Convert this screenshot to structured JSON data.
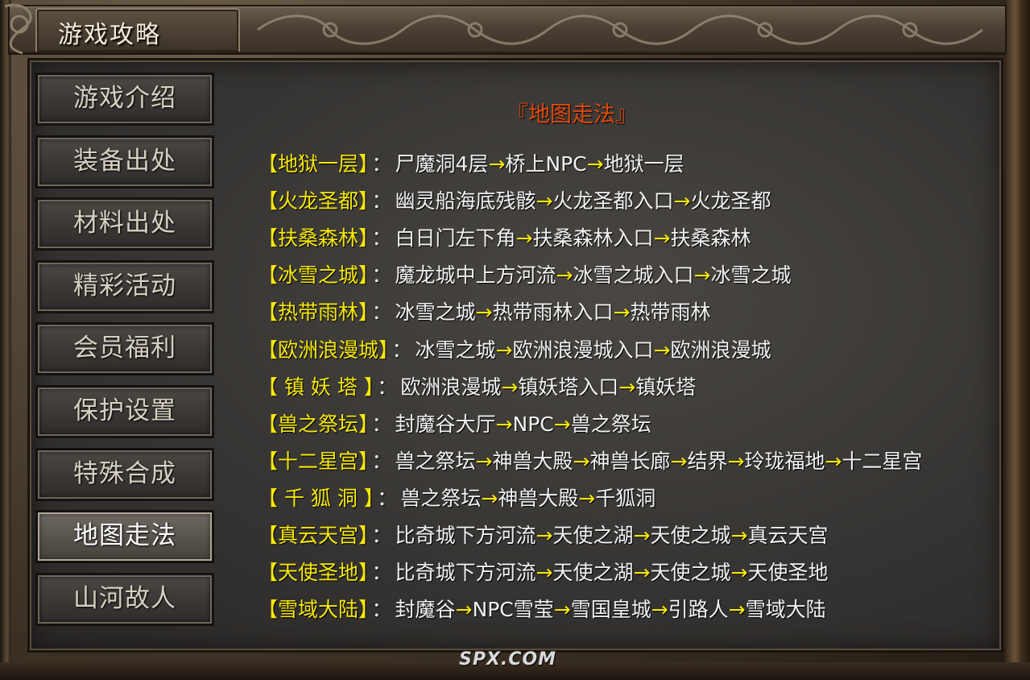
{
  "window": {
    "title": "游戏攻略"
  },
  "sidebar": {
    "items": [
      {
        "label": "游戏介绍",
        "active": false
      },
      {
        "label": "装备出处",
        "active": false
      },
      {
        "label": "材料出处",
        "active": false
      },
      {
        "label": "精彩活动",
        "active": false
      },
      {
        "label": "会员福利",
        "active": false
      },
      {
        "label": "保护设置",
        "active": false
      },
      {
        "label": "特殊合成",
        "active": false
      },
      {
        "label": "地图走法",
        "active": true
      },
      {
        "label": "山河故人",
        "active": false
      }
    ]
  },
  "content": {
    "title": "『地图走法』",
    "separator": "：",
    "arrow": "→",
    "routes": [
      {
        "name": "【地狱一层】",
        "steps": [
          "尸魔洞4层",
          "桥上NPC",
          "地狱一层"
        ]
      },
      {
        "name": "【火龙圣都】",
        "steps": [
          "幽灵船海底残骸",
          "火龙圣都入口",
          "火龙圣都"
        ]
      },
      {
        "name": "【扶桑森林】",
        "steps": [
          "白日门左下角",
          "扶桑森林入口",
          "扶桑森林"
        ]
      },
      {
        "name": "【冰雪之城】",
        "steps": [
          "魔龙城中上方河流",
          "冰雪之城入口",
          "冰雪之城"
        ]
      },
      {
        "name": "【热带雨林】",
        "steps": [
          "冰雪之城",
          "热带雨林入口",
          "热带雨林"
        ]
      },
      {
        "name": "【欧洲浪漫城】",
        "steps": [
          "冰雪之城",
          "欧洲浪漫城入口",
          "欧洲浪漫城"
        ]
      },
      {
        "name": "【 镇 妖 塔 】",
        "steps": [
          "欧洲浪漫城",
          "镇妖塔入口",
          "镇妖塔"
        ]
      },
      {
        "name": "【兽之祭坛】",
        "steps": [
          "封魔谷大厅",
          "NPC",
          "兽之祭坛"
        ]
      },
      {
        "name": "【十二星宫】",
        "steps": [
          "兽之祭坛",
          "神兽大殿",
          "神兽长廊",
          "结界",
          "玲珑福地",
          "十二星宫"
        ]
      },
      {
        "name": "【 千 狐 洞 】",
        "steps": [
          "兽之祭坛",
          "神兽大殿",
          "千狐洞"
        ]
      },
      {
        "name": "【真云天宫】",
        "steps": [
          "比奇城下方河流",
          "天使之湖",
          "天使之城",
          "真云天宫"
        ]
      },
      {
        "name": "【天使圣地】",
        "steps": [
          "比奇城下方河流",
          "天使之湖",
          "天使之城",
          "天使圣地"
        ]
      },
      {
        "name": "【雪域大陆】",
        "steps": [
          "封魔谷",
          "NPC雪莹",
          "雪国皇城",
          "引路人",
          "雪域大陆"
        ]
      }
    ]
  },
  "watermark": "SPX.COM",
  "colors": {
    "location_yellow": "#f5e80a",
    "title_orange": "#e04a0c",
    "text_white": "#f2f2f2"
  }
}
